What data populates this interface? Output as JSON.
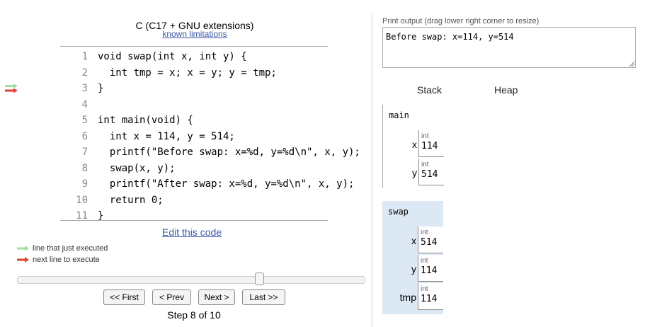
{
  "editor": {
    "language": "C (C17 + GNU extensions)",
    "limitations_link": "known limitations",
    "lines": [
      {
        "num": "1",
        "text": "void swap(int x, int y) {"
      },
      {
        "num": "2",
        "text": "  int tmp = x; x = y; y = tmp;"
      },
      {
        "num": "3",
        "text": "}"
      },
      {
        "num": "4",
        "text": ""
      },
      {
        "num": "5",
        "text": "int main(void) {"
      },
      {
        "num": "6",
        "text": "  int x = 114, y = 514;"
      },
      {
        "num": "7",
        "text": "  printf(\"Before swap: x=%d, y=%d\\n\", x, y);"
      },
      {
        "num": "8",
        "text": "  swap(x, y);"
      },
      {
        "num": "9",
        "text": "  printf(\"After swap: x=%d, y=%d\\n\", x, y);"
      },
      {
        "num": "10",
        "text": "  return 0;"
      },
      {
        "num": "11",
        "text": "}"
      }
    ],
    "current_line": 3,
    "edit_link": "Edit this code"
  },
  "legend": {
    "executed": "line that just executed",
    "next": "next line to execute",
    "executed_color": "#a0e0a0",
    "next_color": "#e0402f"
  },
  "navigation": {
    "first": "<< First",
    "prev": "< Prev",
    "next": "Next >",
    "last": "Last >>",
    "step_text": "Step 8 of 10",
    "progress": 0.7
  },
  "output": {
    "label": "Print output (drag lower right corner to resize)",
    "text": "Before swap: x=114, y=514"
  },
  "visualizer": {
    "stack_label": "Stack",
    "heap_label": "Heap",
    "frames": [
      {
        "name": "main",
        "vars": [
          {
            "name": "x",
            "type": "int",
            "value": "114"
          },
          {
            "name": "y",
            "type": "int",
            "value": "514"
          }
        ]
      },
      {
        "name": "swap",
        "vars": [
          {
            "name": "x",
            "type": "int",
            "value": "514"
          },
          {
            "name": "y",
            "type": "int",
            "value": "114"
          },
          {
            "name": "tmp",
            "type": "int",
            "value": "114"
          }
        ]
      }
    ]
  }
}
